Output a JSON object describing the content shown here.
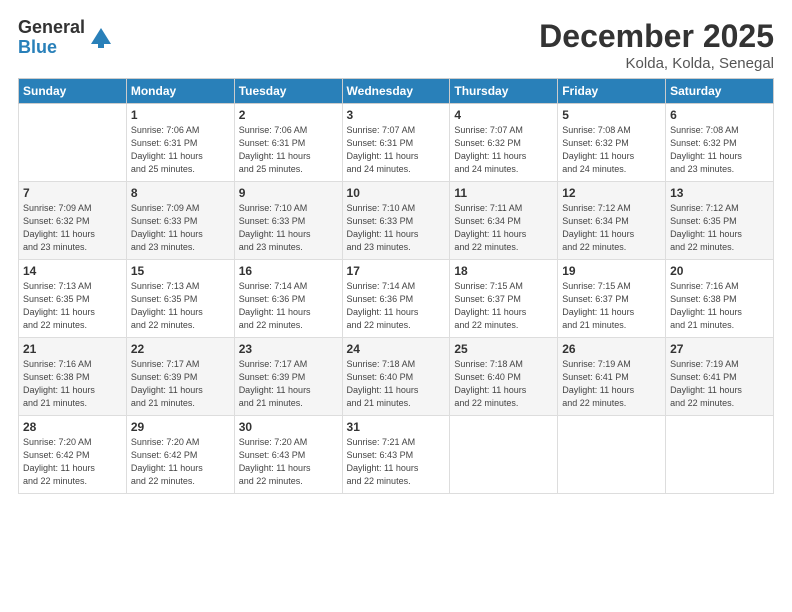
{
  "logo": {
    "general": "General",
    "blue": "Blue"
  },
  "title": "December 2025",
  "subtitle": "Kolda, Kolda, Senegal",
  "weekdays": [
    "Sunday",
    "Monday",
    "Tuesday",
    "Wednesday",
    "Thursday",
    "Friday",
    "Saturday"
  ],
  "weeks": [
    [
      {
        "day": "",
        "info": ""
      },
      {
        "day": "1",
        "info": "Sunrise: 7:06 AM\nSunset: 6:31 PM\nDaylight: 11 hours\nand 25 minutes."
      },
      {
        "day": "2",
        "info": "Sunrise: 7:06 AM\nSunset: 6:31 PM\nDaylight: 11 hours\nand 25 minutes."
      },
      {
        "day": "3",
        "info": "Sunrise: 7:07 AM\nSunset: 6:31 PM\nDaylight: 11 hours\nand 24 minutes."
      },
      {
        "day": "4",
        "info": "Sunrise: 7:07 AM\nSunset: 6:32 PM\nDaylight: 11 hours\nand 24 minutes."
      },
      {
        "day": "5",
        "info": "Sunrise: 7:08 AM\nSunset: 6:32 PM\nDaylight: 11 hours\nand 24 minutes."
      },
      {
        "day": "6",
        "info": "Sunrise: 7:08 AM\nSunset: 6:32 PM\nDaylight: 11 hours\nand 23 minutes."
      }
    ],
    [
      {
        "day": "7",
        "info": "Sunrise: 7:09 AM\nSunset: 6:32 PM\nDaylight: 11 hours\nand 23 minutes."
      },
      {
        "day": "8",
        "info": "Sunrise: 7:09 AM\nSunset: 6:33 PM\nDaylight: 11 hours\nand 23 minutes."
      },
      {
        "day": "9",
        "info": "Sunrise: 7:10 AM\nSunset: 6:33 PM\nDaylight: 11 hours\nand 23 minutes."
      },
      {
        "day": "10",
        "info": "Sunrise: 7:10 AM\nSunset: 6:33 PM\nDaylight: 11 hours\nand 23 minutes."
      },
      {
        "day": "11",
        "info": "Sunrise: 7:11 AM\nSunset: 6:34 PM\nDaylight: 11 hours\nand 22 minutes."
      },
      {
        "day": "12",
        "info": "Sunrise: 7:12 AM\nSunset: 6:34 PM\nDaylight: 11 hours\nand 22 minutes."
      },
      {
        "day": "13",
        "info": "Sunrise: 7:12 AM\nSunset: 6:35 PM\nDaylight: 11 hours\nand 22 minutes."
      }
    ],
    [
      {
        "day": "14",
        "info": "Sunrise: 7:13 AM\nSunset: 6:35 PM\nDaylight: 11 hours\nand 22 minutes."
      },
      {
        "day": "15",
        "info": "Sunrise: 7:13 AM\nSunset: 6:35 PM\nDaylight: 11 hours\nand 22 minutes."
      },
      {
        "day": "16",
        "info": "Sunrise: 7:14 AM\nSunset: 6:36 PM\nDaylight: 11 hours\nand 22 minutes."
      },
      {
        "day": "17",
        "info": "Sunrise: 7:14 AM\nSunset: 6:36 PM\nDaylight: 11 hours\nand 22 minutes."
      },
      {
        "day": "18",
        "info": "Sunrise: 7:15 AM\nSunset: 6:37 PM\nDaylight: 11 hours\nand 22 minutes."
      },
      {
        "day": "19",
        "info": "Sunrise: 7:15 AM\nSunset: 6:37 PM\nDaylight: 11 hours\nand 21 minutes."
      },
      {
        "day": "20",
        "info": "Sunrise: 7:16 AM\nSunset: 6:38 PM\nDaylight: 11 hours\nand 21 minutes."
      }
    ],
    [
      {
        "day": "21",
        "info": "Sunrise: 7:16 AM\nSunset: 6:38 PM\nDaylight: 11 hours\nand 21 minutes."
      },
      {
        "day": "22",
        "info": "Sunrise: 7:17 AM\nSunset: 6:39 PM\nDaylight: 11 hours\nand 21 minutes."
      },
      {
        "day": "23",
        "info": "Sunrise: 7:17 AM\nSunset: 6:39 PM\nDaylight: 11 hours\nand 21 minutes."
      },
      {
        "day": "24",
        "info": "Sunrise: 7:18 AM\nSunset: 6:40 PM\nDaylight: 11 hours\nand 21 minutes."
      },
      {
        "day": "25",
        "info": "Sunrise: 7:18 AM\nSunset: 6:40 PM\nDaylight: 11 hours\nand 22 minutes."
      },
      {
        "day": "26",
        "info": "Sunrise: 7:19 AM\nSunset: 6:41 PM\nDaylight: 11 hours\nand 22 minutes."
      },
      {
        "day": "27",
        "info": "Sunrise: 7:19 AM\nSunset: 6:41 PM\nDaylight: 11 hours\nand 22 minutes."
      }
    ],
    [
      {
        "day": "28",
        "info": "Sunrise: 7:20 AM\nSunset: 6:42 PM\nDaylight: 11 hours\nand 22 minutes."
      },
      {
        "day": "29",
        "info": "Sunrise: 7:20 AM\nSunset: 6:42 PM\nDaylight: 11 hours\nand 22 minutes."
      },
      {
        "day": "30",
        "info": "Sunrise: 7:20 AM\nSunset: 6:43 PM\nDaylight: 11 hours\nand 22 minutes."
      },
      {
        "day": "31",
        "info": "Sunrise: 7:21 AM\nSunset: 6:43 PM\nDaylight: 11 hours\nand 22 minutes."
      },
      {
        "day": "",
        "info": ""
      },
      {
        "day": "",
        "info": ""
      },
      {
        "day": "",
        "info": ""
      }
    ]
  ]
}
